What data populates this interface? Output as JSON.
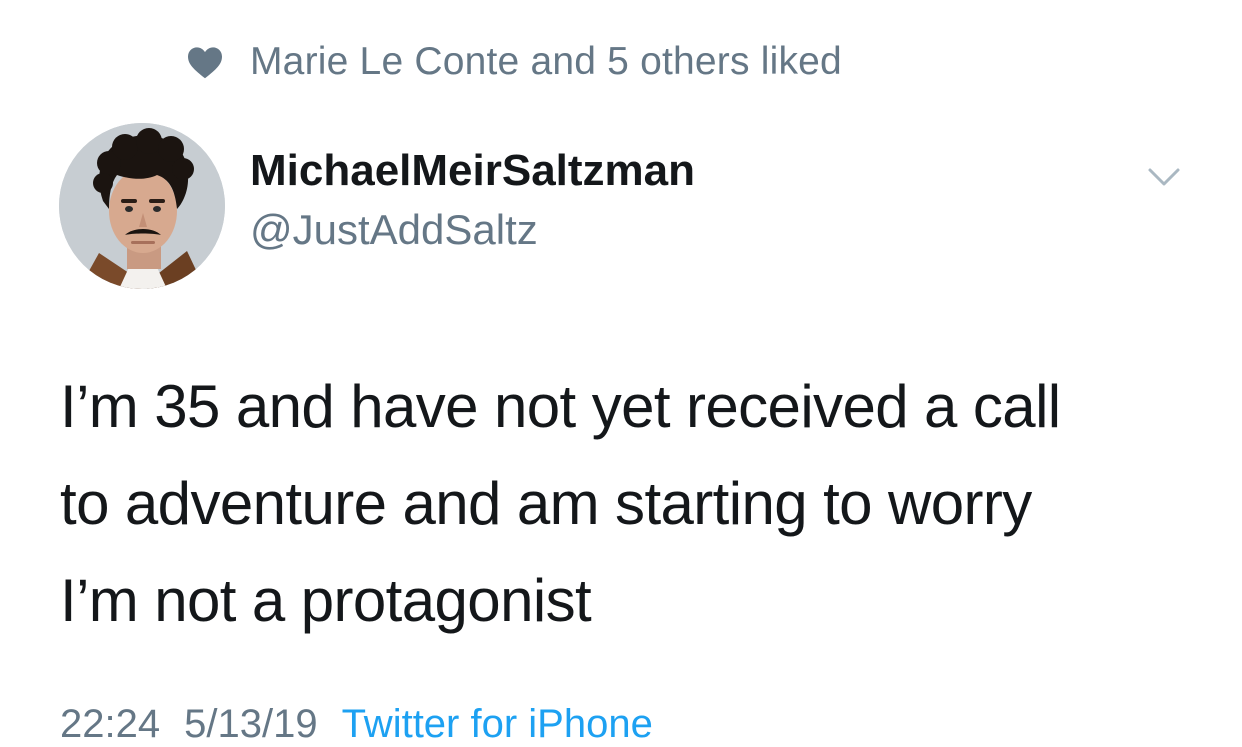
{
  "social_context": {
    "text": "Marie Le Conte and 5 others liked",
    "icon": "heart-icon",
    "color": "#657786"
  },
  "author": {
    "display_name": "MichaelMeirSaltzman",
    "handle": "@JustAddSaltz",
    "avatar_icon": "avatar"
  },
  "tweet": {
    "lines": [
      "I’m 35 and have not yet received a call",
      "to adventure and am starting to worry",
      "I’m not a protagonist"
    ]
  },
  "meta": {
    "time": "22:24",
    "date": "5/13/19",
    "source": "Twitter for iPhone"
  },
  "colors": {
    "text_primary": "#14171a",
    "text_secondary": "#657786",
    "link": "#1da1f2"
  }
}
